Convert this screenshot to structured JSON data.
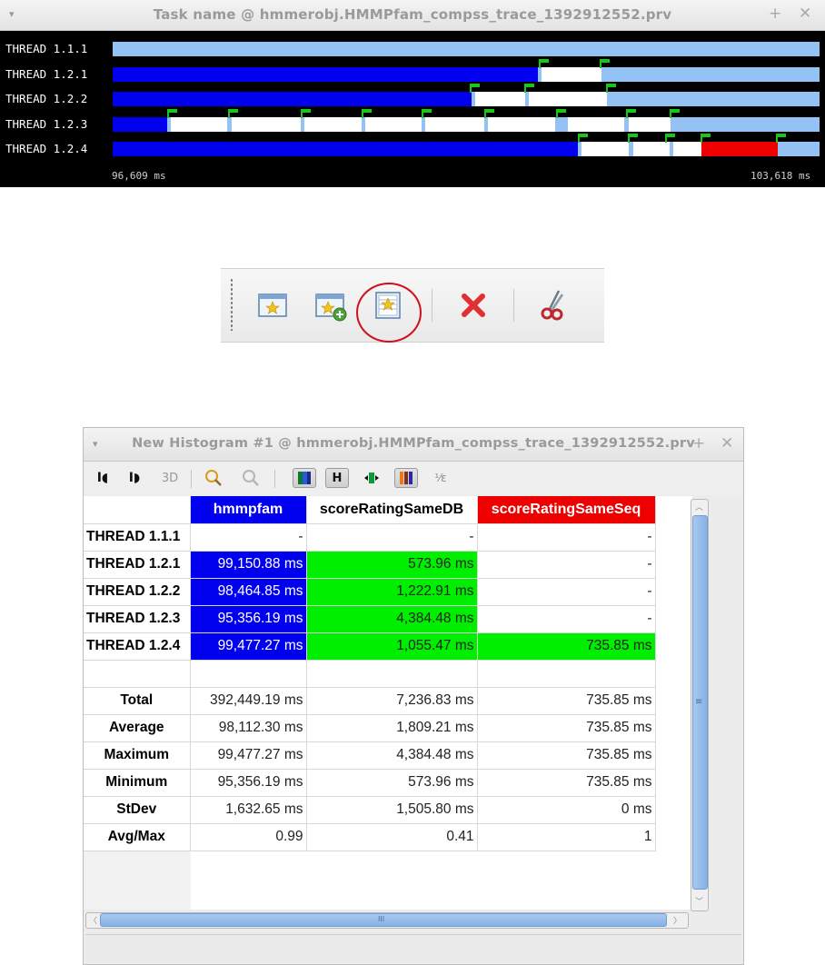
{
  "trace_window": {
    "title": "Task name @ hmmerobj.HMMPfam_compss_trace_1392912552.prv",
    "controls": {
      "menu": "▾",
      "maximize": "+",
      "close": "✕"
    },
    "threads": [
      "THREAD 1.1.1",
      "THREAD 1.2.1",
      "THREAD 1.2.2",
      "THREAD 1.2.3",
      "THREAD 1.2.4"
    ],
    "time_start": "96,609 ms",
    "time_end": "103,618 ms",
    "colors": {
      "background": "#000000",
      "idle": "#94c2f4",
      "hmmpfam": "#0000ee",
      "white": "#ffffff",
      "scoreRatingSameSeq": "#ee0000",
      "flag": "#19c719"
    }
  },
  "toolbar": {
    "buttons": [
      {
        "name": "new-window-icon"
      },
      {
        "name": "new-window-add-icon"
      },
      {
        "name": "new-histogram-icon",
        "highlighted": true
      },
      {
        "name": "delete-icon"
      },
      {
        "name": "cut-icon"
      }
    ]
  },
  "histogram_window": {
    "title": "New Histogram #1 @ hmmerobj.HMMPfam_compss_trace_1392912552.prv",
    "controls": {
      "menu": "▾",
      "maximize": "+",
      "close": "✕"
    },
    "toolbar": {
      "open_control": "I◖",
      "open_data": "I◗",
      "three_d": "3D",
      "h_button": "H",
      "fraction": "⅟ε"
    },
    "columns": [
      {
        "label": "hmmpfam",
        "color": "#0000ee",
        "text_color": "#ffffff"
      },
      {
        "label": "scoreRatingSameDB",
        "color": "#ffffff",
        "text_color": "#000000"
      },
      {
        "label": "scoreRatingSameSeq",
        "color": "#ee0000",
        "text_color": "#ffffff"
      }
    ],
    "rows": [
      {
        "label": "THREAD 1.1.1",
        "values": [
          "-",
          "-",
          "-"
        ]
      },
      {
        "label": "THREAD 1.2.1",
        "values": [
          "99,150.88 ms",
          "573.96 ms",
          "-"
        ]
      },
      {
        "label": "THREAD 1.2.2",
        "values": [
          "98,464.85 ms",
          "1,222.91 ms",
          "-"
        ]
      },
      {
        "label": "THREAD 1.2.3",
        "values": [
          "95,356.19 ms",
          "4,384.48 ms",
          "-"
        ]
      },
      {
        "label": "THREAD 1.2.4",
        "values": [
          "99,477.27 ms",
          "1,055.47 ms",
          "735.85 ms"
        ]
      }
    ],
    "stats": [
      {
        "label": "Total",
        "values": [
          "392,449.19 ms",
          "7,236.83 ms",
          "735.85 ms"
        ]
      },
      {
        "label": "Average",
        "values": [
          "98,112.30 ms",
          "1,809.21 ms",
          "735.85 ms"
        ]
      },
      {
        "label": "Maximum",
        "values": [
          "99,477.27 ms",
          "4,384.48 ms",
          "735.85 ms"
        ]
      },
      {
        "label": "Minimum",
        "values": [
          "95,356.19 ms",
          "573.96 ms",
          "735.85 ms"
        ]
      },
      {
        "label": "StDev",
        "values": [
          "1,632.65 ms",
          "1,505.80 ms",
          "0 ms"
        ]
      },
      {
        "label": "Avg/Max",
        "values": [
          "0.99",
          "0.41",
          "1"
        ]
      }
    ],
    "cell_colors": {
      "blue": "#0000ee",
      "green": "#00ee00"
    },
    "hscroll_mark": "III",
    "vscroll_mark": "≡"
  }
}
